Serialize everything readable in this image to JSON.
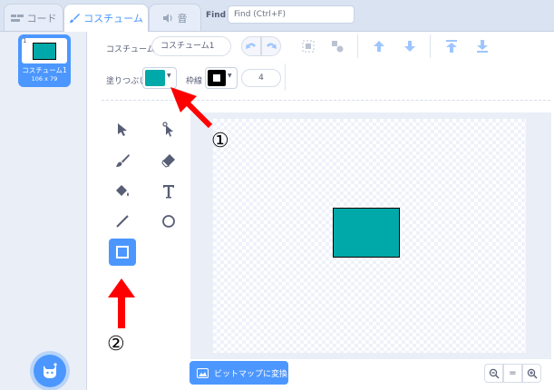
{
  "tabs": [
    {
      "label": "コード",
      "icon": "code-icon"
    },
    {
      "label": "コスチューム",
      "icon": "brush-icon"
    },
    {
      "label": "音",
      "icon": "speaker-icon"
    }
  ],
  "find": {
    "label": "Find",
    "placeholder": "Find (Ctrl+F)"
  },
  "costume_list": [
    {
      "index": "1",
      "name": "コスチューム1",
      "size": "106 x 79"
    }
  ],
  "toolbar": {
    "costume_label": "コスチューム",
    "costume_name": "コスチューム1",
    "fill_label": "塗りつぶし",
    "fill_color": "#00a9a9",
    "outline_label": "枠線",
    "outline_color": "#000000",
    "outline_width": "4"
  },
  "tools": [
    "select-icon",
    "reshape-icon",
    "brush-icon",
    "eraser-icon",
    "fill-icon",
    "text-icon",
    "line-icon",
    "circle-icon",
    "rectangle-icon"
  ],
  "selected_tool": "rectangle-icon",
  "canvas": {
    "shape_fill": "#00a9a9",
    "shape_outline": "#000000"
  },
  "bottom": {
    "bitmap_button": "ビットマップに変換",
    "zoom_reset": "="
  },
  "annotations": {
    "arrow_color": "#ff0000",
    "badge1": "①",
    "badge2": "②"
  }
}
